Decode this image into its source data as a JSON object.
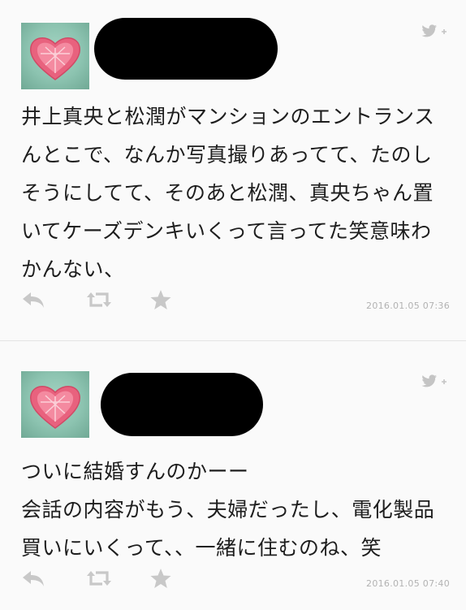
{
  "tweets": [
    {
      "text": "井上真央と松潤がマンションのエントランスんとこで、なんか写真撮りあってて、たのしそうにしてて、そのあと松潤、真央ちゃん置いてケーズデンキいくって言ってた笑意味わかんない、",
      "timestamp": "2016.01.05 07:36",
      "avatar_icon": "heart-avatar",
      "follow_icon": "twitter-bird-plus-icon"
    },
    {
      "text": "ついに結婚すんのかーー\n会話の内容がもう、夫婦だったし、電化製品買いにいくって、、一緒に住むのね、笑",
      "timestamp": "2016.01.05 07:40",
      "avatar_icon": "heart-avatar",
      "follow_icon": "twitter-bird-plus-icon"
    }
  ],
  "actions": [
    "reply-icon",
    "retweet-icon",
    "favorite-icon"
  ],
  "colors": {
    "background": "#fafafa",
    "text": "#1e1e1e",
    "icon": "#c8c8c8",
    "timestamp": "#b2b2b2",
    "redaction": "#000000"
  }
}
